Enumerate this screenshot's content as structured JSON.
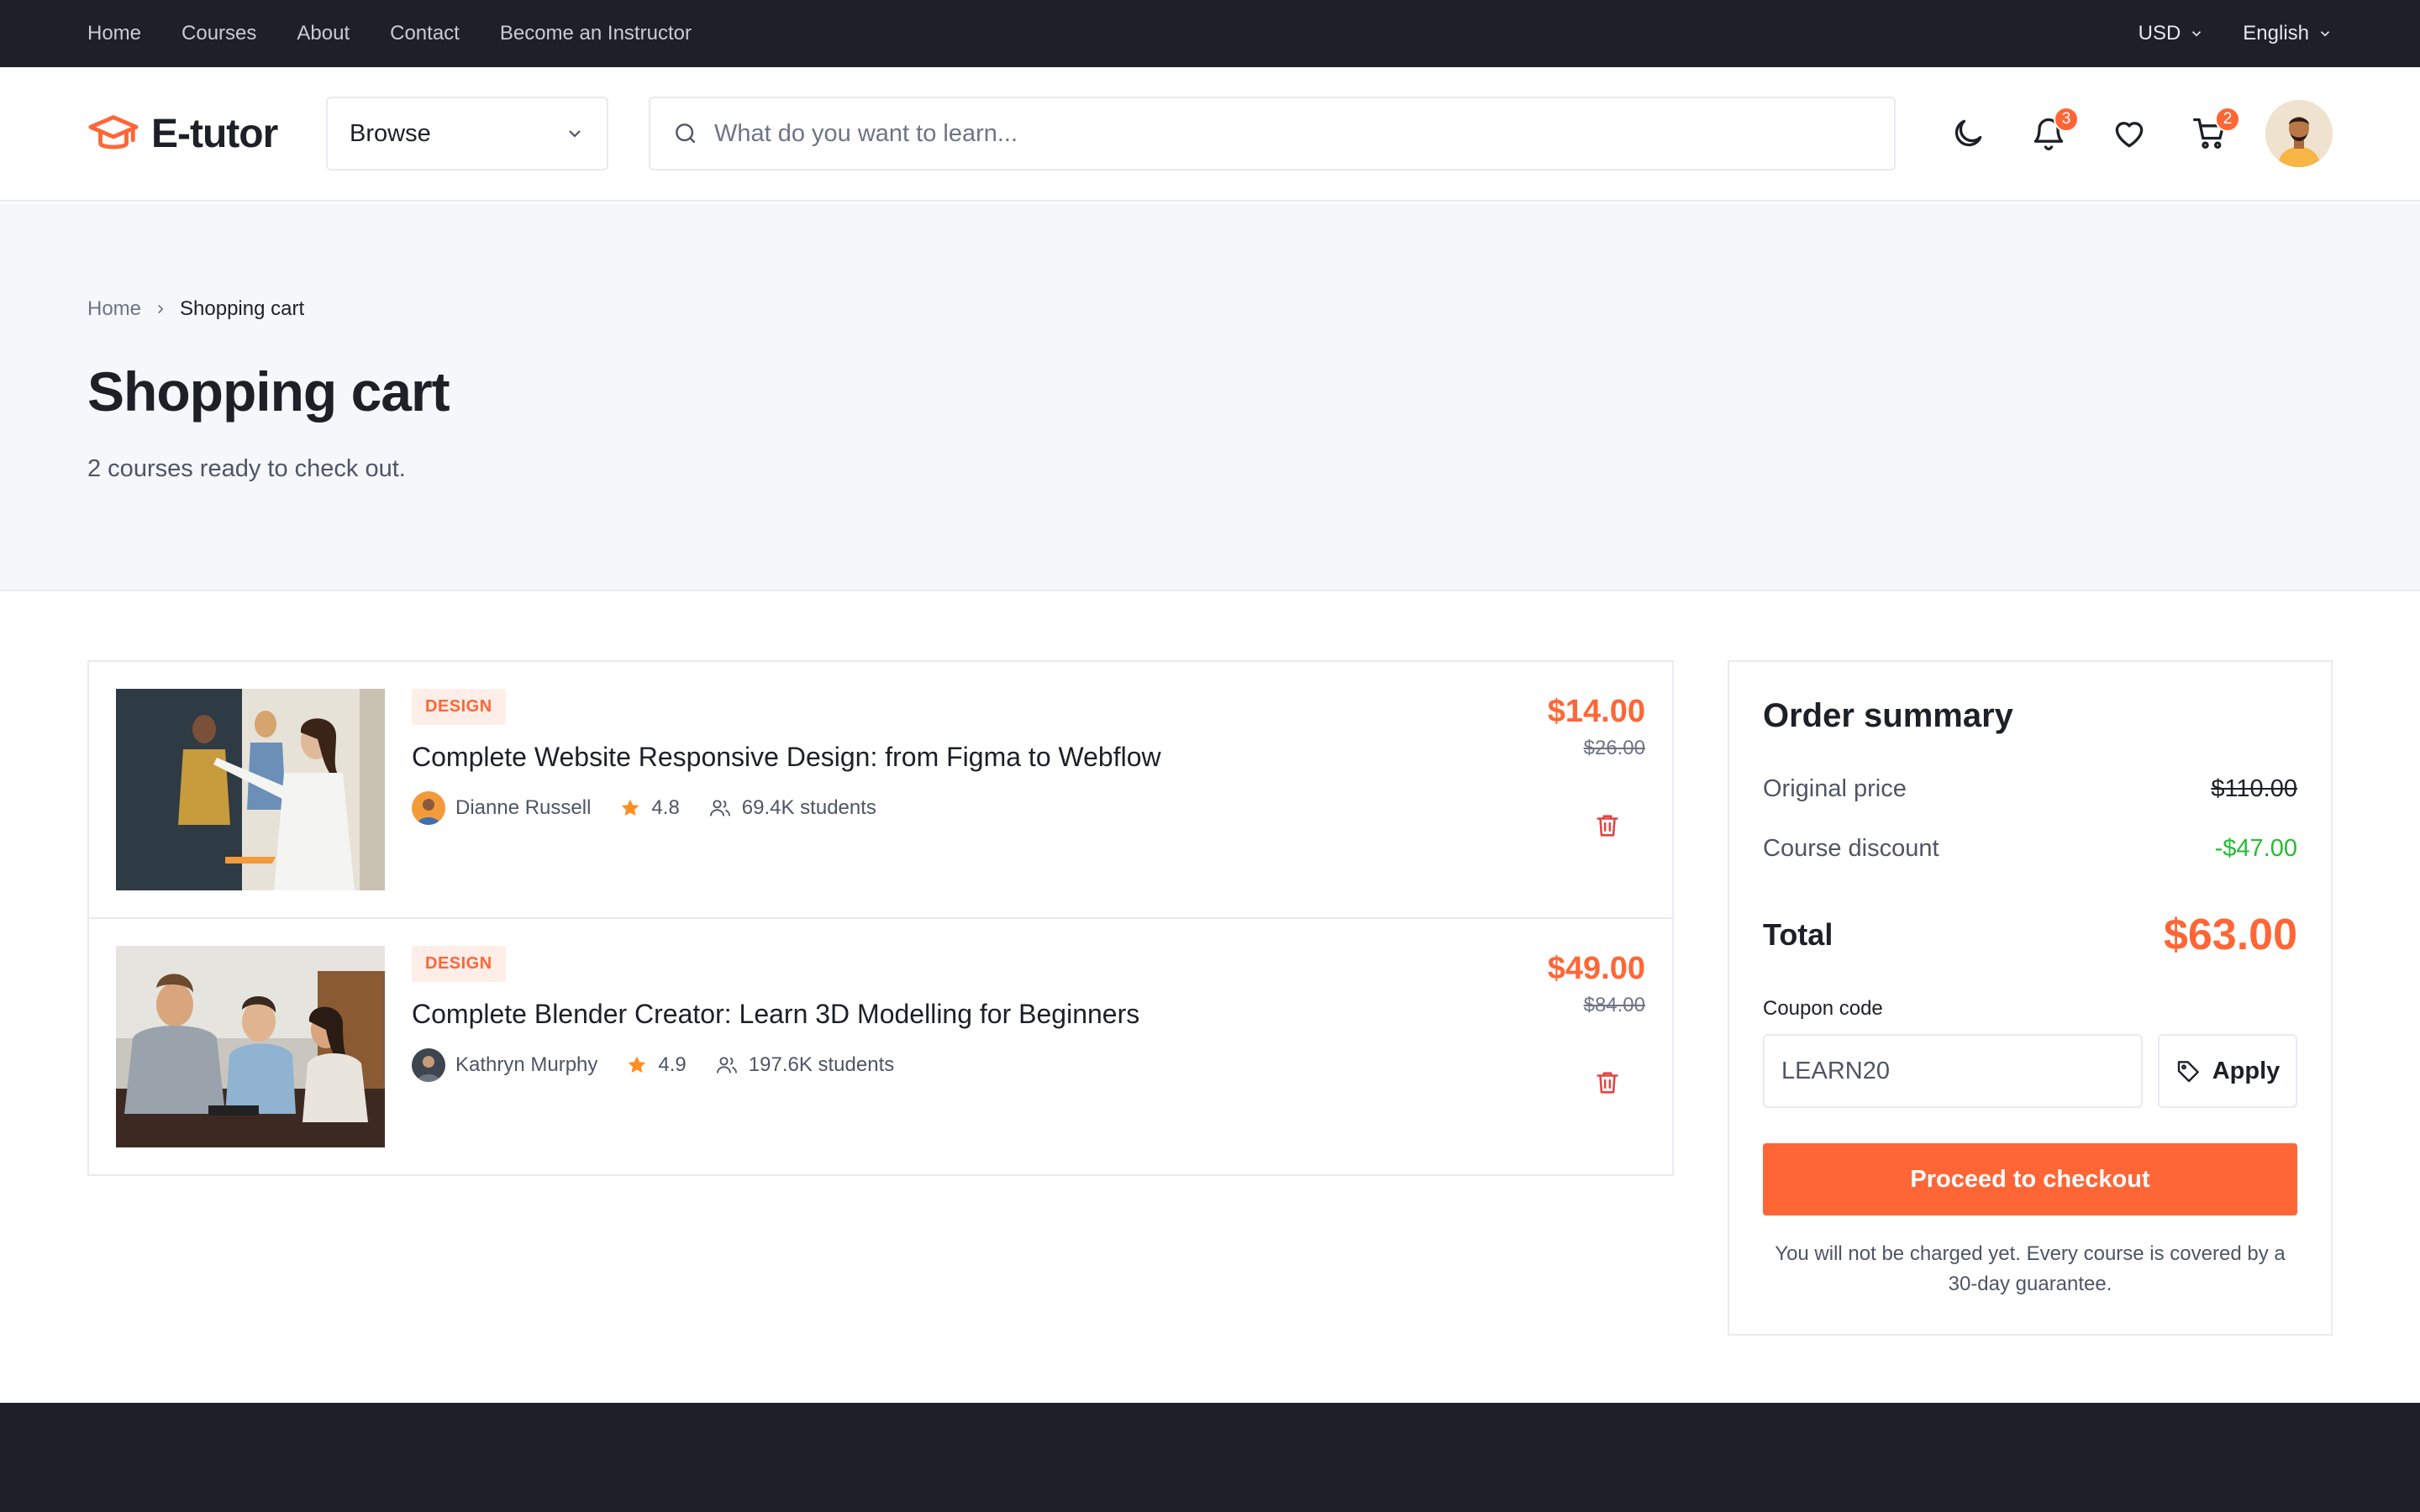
{
  "topbar": {
    "nav": [
      "Home",
      "Courses",
      "About",
      "Contact",
      "Become an Instructor"
    ],
    "currency": "USD",
    "language": "English"
  },
  "header": {
    "logo_text": "E-tutor",
    "browse_label": "Browse",
    "search_placeholder": "What do you want to learn...",
    "notifications_count": "3",
    "cart_count": "2"
  },
  "hero": {
    "breadcrumb": [
      "Home",
      "Shopping cart"
    ],
    "title": "Shopping cart",
    "subtitle": "2 courses ready to check out."
  },
  "cart": {
    "items": [
      {
        "category": "DESIGN",
        "title": "Complete Website Responsive Design: from Figma to Webflow",
        "instructor": "Dianne Russell",
        "rating": "4.8",
        "students": "69.4K students",
        "price": "$14.00",
        "original_price": "$26.00"
      },
      {
        "category": "DESIGN",
        "title": "Complete Blender Creator: Learn 3D Modelling for Beginners",
        "instructor": "Kathryn Murphy",
        "rating": "4.9",
        "students": "197.6K students",
        "price": "$49.00",
        "original_price": "$84.00"
      }
    ]
  },
  "summary": {
    "title": "Order summary",
    "original_label": "Original price",
    "original_value": "$110.00",
    "discount_label": "Course discount",
    "discount_value": "-$47.00",
    "total_label": "Total",
    "total_value": "$63.00",
    "coupon_label": "Coupon code",
    "coupon_value": "LEARN20",
    "apply_label": "Apply",
    "checkout_label": "Proceed to checkout",
    "note": "You will not be charged yet. Every course is covered by a 30-day guarantee."
  },
  "colors": {
    "accent": "#ff6636",
    "dark": "#1d2026",
    "discount": "#23bd33",
    "hero_bg": "#f5f7fa"
  }
}
